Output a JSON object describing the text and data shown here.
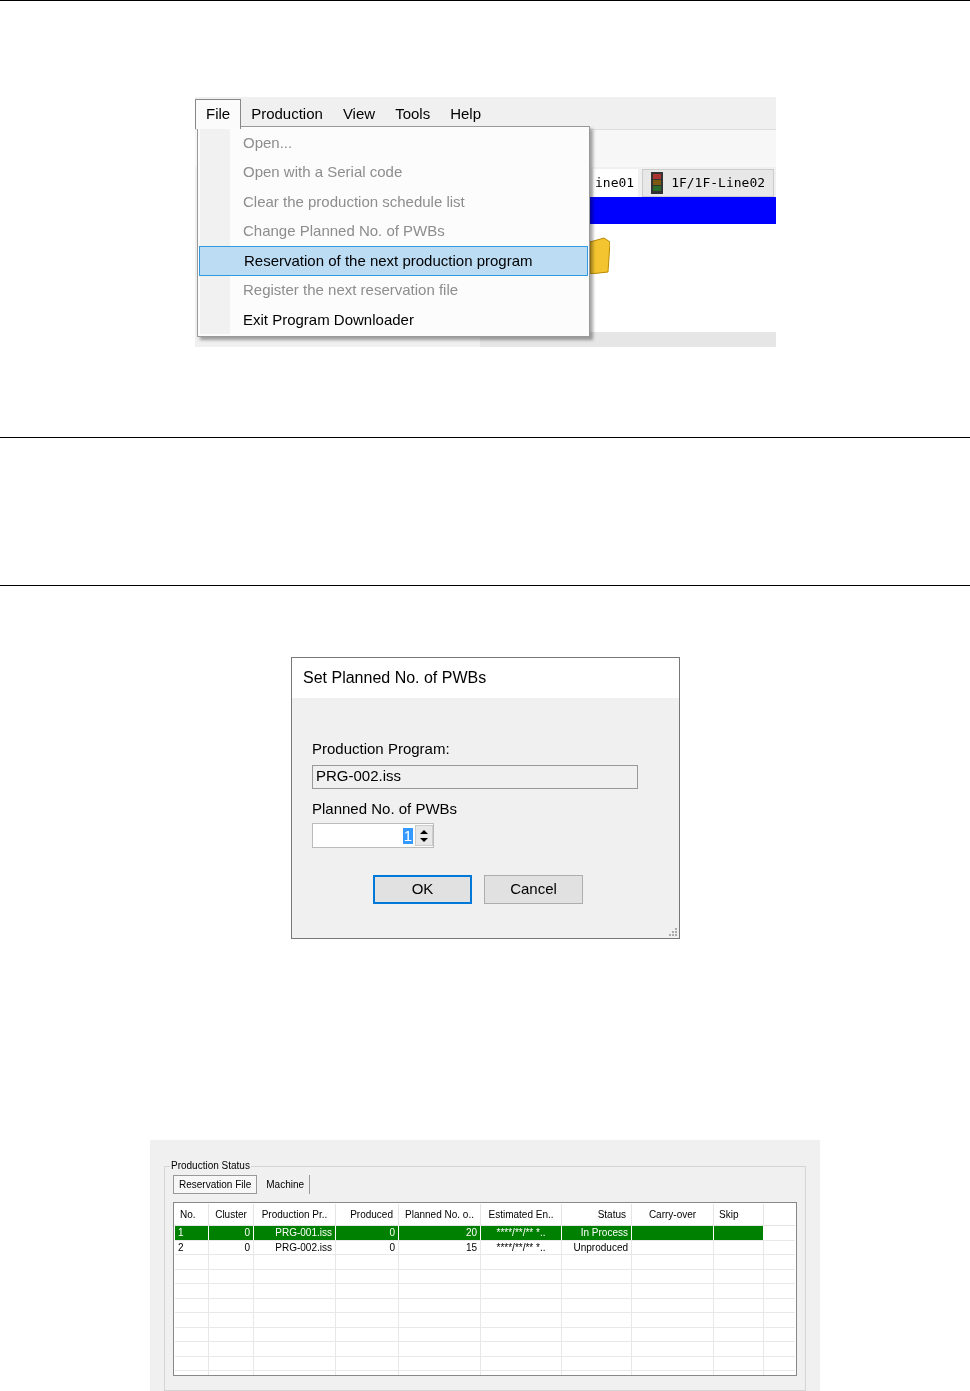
{
  "app_window": {
    "menu_bar": [
      {
        "label": "File",
        "selected": true
      },
      {
        "label": "Production",
        "selected": false
      },
      {
        "label": "View",
        "selected": false
      },
      {
        "label": "Tools",
        "selected": false
      },
      {
        "label": "Help",
        "selected": false
      }
    ],
    "line_tabs": [
      {
        "label": "ine01",
        "selected": true
      },
      {
        "label": "1F/1F-Line02",
        "selected": false
      }
    ],
    "file_menu": [
      {
        "label": "Open...",
        "disabled": true,
        "selected": false
      },
      {
        "label": "Open with a Serial code",
        "disabled": true,
        "selected": false
      },
      {
        "label": "Clear the production schedule list",
        "disabled": true,
        "selected": false
      },
      {
        "label": "Change Planned No. of PWBs",
        "disabled": true,
        "selected": false
      },
      {
        "label": "Reservation of the next production program",
        "disabled": false,
        "selected": true
      },
      {
        "label": "Register the next reservation file",
        "disabled": true,
        "selected": false
      },
      {
        "label": "Exit Program Downloader",
        "disabled": false,
        "selected": false
      }
    ]
  },
  "dialog": {
    "title": "Set Planned No. of PWBs",
    "program_label": "Production Program:",
    "program_value": "PRG-002.iss",
    "planned_label": "Planned No. of PWBs",
    "planned_value": "1",
    "buttons": [
      {
        "label": "OK",
        "selected": true
      },
      {
        "label": "Cancel",
        "selected": false
      }
    ]
  },
  "production_status": {
    "title": "Production Status",
    "tabs": [
      {
        "label": "Reservation File",
        "selected": true
      },
      {
        "label": "Machine",
        "selected": false
      }
    ],
    "columns": [
      "No.",
      "Cluster",
      "Production Pr..",
      "Produced",
      "Planned No. o..",
      "Estimated En..",
      "Status",
      "Carry-over",
      "Skip"
    ],
    "rows": [
      {
        "selected": true,
        "cells": [
          "1",
          "0",
          "PRG-001.iss",
          "0",
          "20",
          "****/**/** *..",
          "In Process",
          "",
          ""
        ]
      },
      {
        "selected": false,
        "cells": [
          "2",
          "0",
          "PRG-002.iss",
          "0",
          "15",
          "****/**/** *..",
          "Unproduced",
          "",
          ""
        ]
      }
    ]
  }
}
